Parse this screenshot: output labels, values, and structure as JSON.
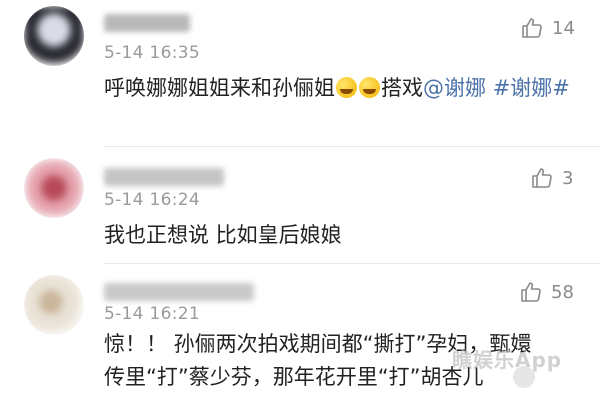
{
  "comments": [
    {
      "time": "5-14 16:35",
      "likes": "14",
      "text_parts": [
        "呼唤娜娜姐姐来和孙俪姐",
        "搭戏"
      ],
      "mention": "@谢娜",
      "topic_a": "#谢",
      "topic_b": "娜#"
    },
    {
      "time": "5-14 16:24",
      "likes": "3",
      "text": "我也正想说 比如皇后娘娘"
    },
    {
      "time": "5-14 16:21",
      "likes": "58",
      "line1": "惊！！ 孙俪两次拍戏期间都“撕打”孕妇，甄嬛",
      "line2": "传里“打”蔡少芬，那年花开里“打”胡杏儿"
    }
  ],
  "watermark": "瞧娱乐App",
  "icons": {
    "like": "thumbs-up-icon",
    "emoji": "grin-emoji-icon"
  },
  "colors": {
    "link": "#4c72a8",
    "meta": "#9a9a9a",
    "like": "#8a8a8a"
  }
}
